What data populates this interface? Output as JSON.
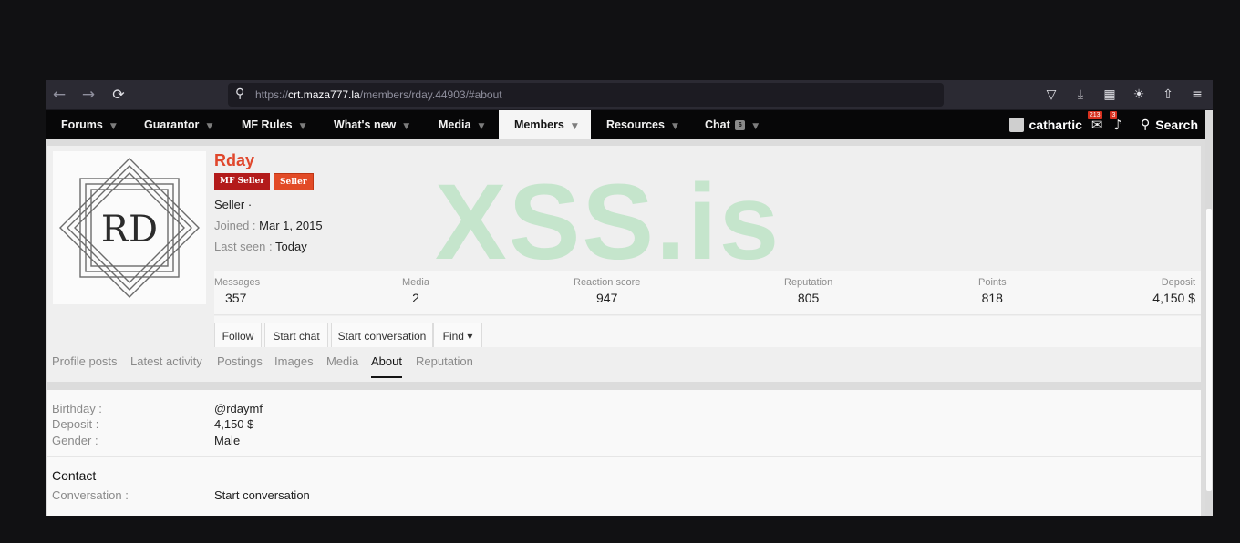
{
  "browser": {
    "url_prefix": "https://",
    "url_host": "crt.maza777.la",
    "url_path": "/members/rday.44903/#about",
    "toolbar_icons": [
      "pocket-icon",
      "download-icon",
      "translate-icon",
      "palette-icon",
      "share-icon",
      "menu-icon"
    ]
  },
  "nav": {
    "tabs": [
      "Forums",
      "Guarantor",
      "MF Rules",
      "What's new",
      "Media",
      "Members",
      "Resources",
      "Chat"
    ],
    "active": "Members",
    "chat_badge": "6",
    "username": "cathartic",
    "mail_badge": "213",
    "bell_badge": "3",
    "search_label": "Search"
  },
  "profile": {
    "avatar_text": "RD",
    "name": "Rday",
    "banners": [
      "MF Seller",
      "Seller"
    ],
    "title": "Seller ·",
    "joined_label": "Joined :",
    "joined_value": "Mar 1, 2015",
    "lastseen_label": "Last seen :",
    "lastseen_value": "Today",
    "stats": [
      {
        "label": "Messages",
        "value": "357"
      },
      {
        "label": "Media",
        "value": "2"
      },
      {
        "label": "Reaction score",
        "value": "947"
      },
      {
        "label": "Reputation",
        "value": "805"
      },
      {
        "label": "Points",
        "value": "818"
      },
      {
        "label": "Deposit",
        "value": "4,150 $"
      }
    ],
    "buttons": [
      "Follow",
      "Start chat",
      "Start conversation",
      "Find ▾"
    ],
    "tabs": [
      "Profile posts",
      "Latest activity",
      "Postings",
      "Images",
      "Media",
      "About",
      "Reputation"
    ],
    "active_tab": "About"
  },
  "about": {
    "rows": [
      {
        "label": "Birthday :",
        "value": "@rdaymf"
      },
      {
        "label": "Deposit :",
        "value": "4,150 $"
      },
      {
        "label": "Gender :",
        "value": "Male"
      }
    ],
    "contact_title": "Contact",
    "conversation_label": "Conversation :",
    "conversation_value": "Start conversation"
  },
  "watermark": "XSS.is",
  "colors": {
    "accent": "#e0472c",
    "nav_bg": "#070708",
    "banner_mf": "#b31b1b",
    "banner_seller": "#e24b27",
    "watermark": "#6fd185"
  }
}
